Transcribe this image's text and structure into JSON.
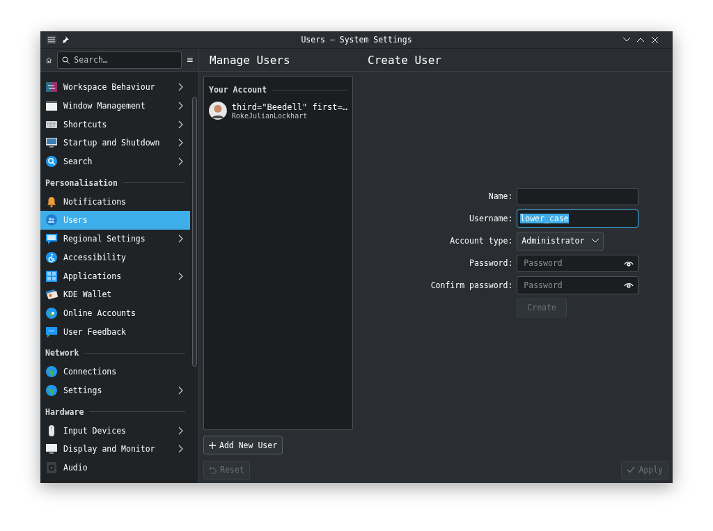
{
  "window": {
    "title": "Users — System Settings"
  },
  "sidebar": {
    "search": {
      "placeholder": "Search…"
    },
    "groups": [
      {
        "items": [
          {
            "label": "Workspace Behaviour",
            "has_children": true,
            "selected": false
          },
          {
            "label": "Window Management",
            "has_children": true,
            "selected": false
          },
          {
            "label": "Shortcuts",
            "has_children": true,
            "selected": false
          },
          {
            "label": "Startup and Shutdown",
            "has_children": true,
            "selected": false
          },
          {
            "label": "Search",
            "has_children": true,
            "selected": false
          }
        ]
      },
      {
        "title": "Personalisation",
        "items": [
          {
            "label": "Notifications",
            "has_children": false,
            "selected": false
          },
          {
            "label": "Users",
            "has_children": false,
            "selected": true
          },
          {
            "label": "Regional Settings",
            "has_children": true,
            "selected": false
          },
          {
            "label": "Accessibility",
            "has_children": false,
            "selected": false
          },
          {
            "label": "Applications",
            "has_children": true,
            "selected": false
          },
          {
            "label": "KDE Wallet",
            "has_children": false,
            "selected": false
          },
          {
            "label": "Online Accounts",
            "has_children": false,
            "selected": false
          },
          {
            "label": "User Feedback",
            "has_children": false,
            "selected": false
          }
        ]
      },
      {
        "title": "Network",
        "items": [
          {
            "label": "Connections",
            "has_children": false,
            "selected": false
          },
          {
            "label": "Settings",
            "has_children": true,
            "selected": false
          }
        ]
      },
      {
        "title": "Hardware",
        "items": [
          {
            "label": "Input Devices",
            "has_children": true,
            "selected": false
          },
          {
            "label": "Display and Monitor",
            "has_children": true,
            "selected": false
          },
          {
            "label": "Audio",
            "has_children": false,
            "selected": false
          }
        ]
      }
    ]
  },
  "manage": {
    "title": "Manage Users",
    "section": "Your Account",
    "accounts": [
      {
        "name": "third=\"Beedell\" first=…",
        "username": "RokeJulianLockhart"
      }
    ],
    "add_button": "Add New User"
  },
  "create": {
    "title": "Create User",
    "fields": [
      {
        "kind": "text",
        "label": "Name:"
      },
      {
        "kind": "text",
        "label": "Username:",
        "value": "lower_case",
        "focused": true
      },
      {
        "kind": "select",
        "label": "Account type:",
        "value": "Administrator"
      },
      {
        "kind": "password",
        "label": "Password:",
        "placeholder": "Password"
      },
      {
        "kind": "password",
        "label": "Confirm password:",
        "placeholder": "Password"
      }
    ],
    "submit": {
      "label": "Create",
      "disabled": true
    }
  },
  "footer": {
    "reset": {
      "label": "Reset",
      "disabled": true
    },
    "apply": {
      "label": "Apply",
      "disabled": true
    }
  }
}
